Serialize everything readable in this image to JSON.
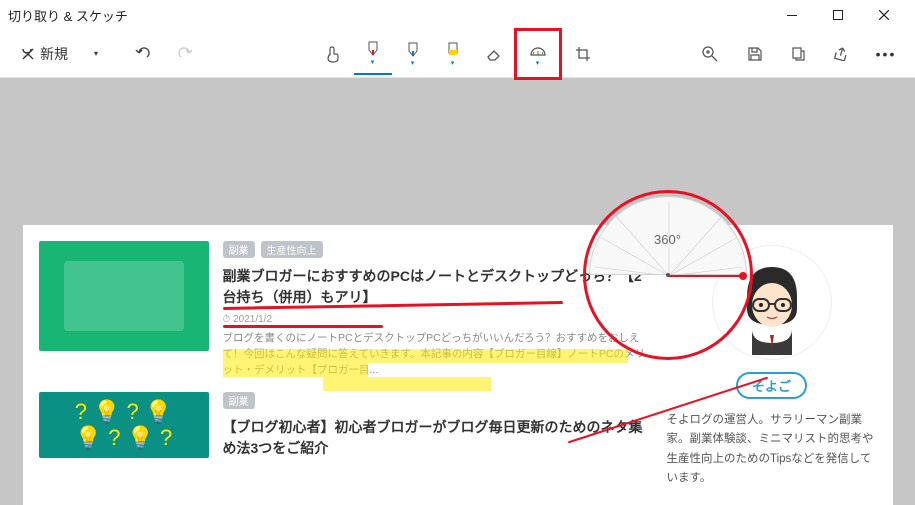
{
  "window": {
    "title": "切り取り & スケッチ"
  },
  "toolbar": {
    "new_label": "新規",
    "protractor_label": "360°"
  },
  "blog": {
    "posts": [
      {
        "tags": [
          "副業",
          "生産性向上"
        ],
        "title": "副業ブロガーにおすすめのPCはノートとデスクトップどっち？【2台持ち（併用）もアリ】",
        "date": "2021/1/2",
        "excerpt": "ブログを書くのにノートPCとデスクトップPCどっちがいいんだろう？おすすめをおしえて！今回はこんな疑問に答えていきます。本記事の内容【ブロガー目線】ノートPCのメリット・デメリット【ブロガー目..."
      },
      {
        "tags": [
          "副業"
        ],
        "title": "【ブログ初心者】初心者ブロガーがブログ毎日更新のためのネタ集め法3つをご紹介"
      }
    ],
    "owner": {
      "name": "そよご",
      "desc": "そよログの運営人。サラリーマン副業家。副業体験談、ミニマリスト的思考や生産性向上のためのTipsなどを発信しています。"
    }
  }
}
